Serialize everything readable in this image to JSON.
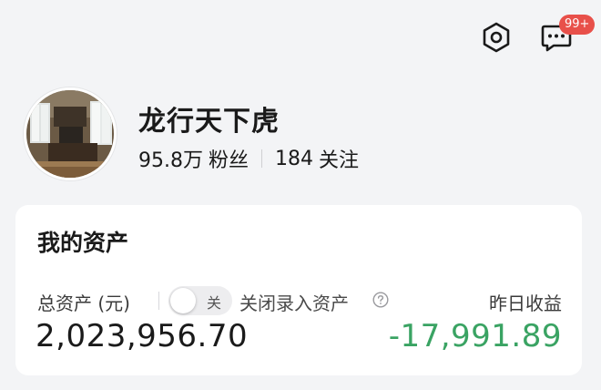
{
  "header": {
    "notification_badge": "99+"
  },
  "icons": {
    "settings": "gear-icon",
    "messages": "chat-bubble-icon",
    "help": "question-circle-icon"
  },
  "profile": {
    "username": "龙行天下虎",
    "followers_count": "95.8万",
    "followers_label": "粉丝",
    "following_count": "184",
    "following_label": "关注"
  },
  "assets": {
    "title": "我的资产",
    "total_label": "总资产 (元)",
    "toggle_text": "关",
    "toggle_on": false,
    "toggle_description": "关闭录入资产",
    "total_value": "2,023,956.70",
    "yesterday_label": "昨日收益",
    "yesterday_value": "-17,991.89"
  },
  "colors": {
    "accent_negative": "#3aa363",
    "badge": "#e8504a",
    "background": "#f3f4f6"
  }
}
